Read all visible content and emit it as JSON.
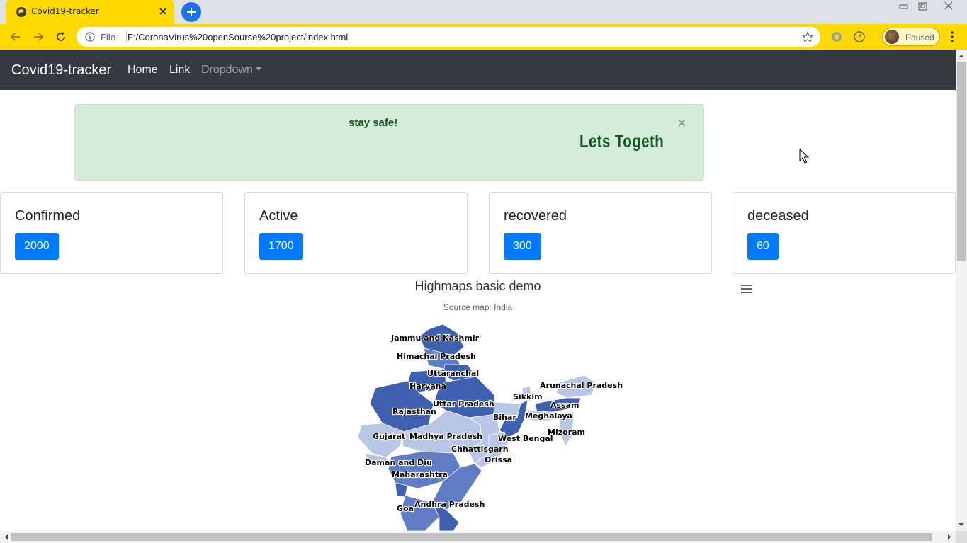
{
  "browser": {
    "tab_title": "Covid19-tracker",
    "file_label": "File",
    "url": "F:/CoronaVirus%20openSourse%20project/index.html",
    "profile_status": "Paused"
  },
  "navbar": {
    "brand": "Covid19-tracker",
    "links": [
      "Home",
      "Link"
    ],
    "dropdown": "Dropdown"
  },
  "alert": {
    "message": "stay safe!",
    "marquee": "Lets Togeth",
    "close": "×"
  },
  "stats": [
    {
      "title": "Confirmed",
      "value": "2000"
    },
    {
      "title": "Active",
      "value": "1700"
    },
    {
      "title": "recovered",
      "value": "300"
    },
    {
      "title": "deceased",
      "value": "60"
    }
  ],
  "map": {
    "title": "Highmaps basic demo",
    "subtitle": "Source map: India",
    "colors": {
      "dark": "#3f5fb0",
      "mid": "#5f7cc4",
      "light": "#b9c7e6"
    },
    "states": [
      "Jammu and Kashmir",
      "Himachal Pradesh",
      "Uttaranchal",
      "Haryana",
      "Rajasthan",
      "Uttar Pradesh",
      "Sikkim",
      "Arunachal Pradesh",
      "Assam",
      "Bihar",
      "Meghalaya",
      "Gujarat",
      "Madhya Pradesh",
      "West Bengal",
      "Mizoram",
      "Chhattisgarh",
      "Daman and Diu",
      "Orissa",
      "Maharashtra",
      "Goa",
      "Andhra Pradesh"
    ]
  },
  "colors": {
    "browser_accent": "#ffd900",
    "navbar_bg": "#343a40",
    "alert_bg": "#d4edda",
    "badge_blue": "#007bff"
  }
}
